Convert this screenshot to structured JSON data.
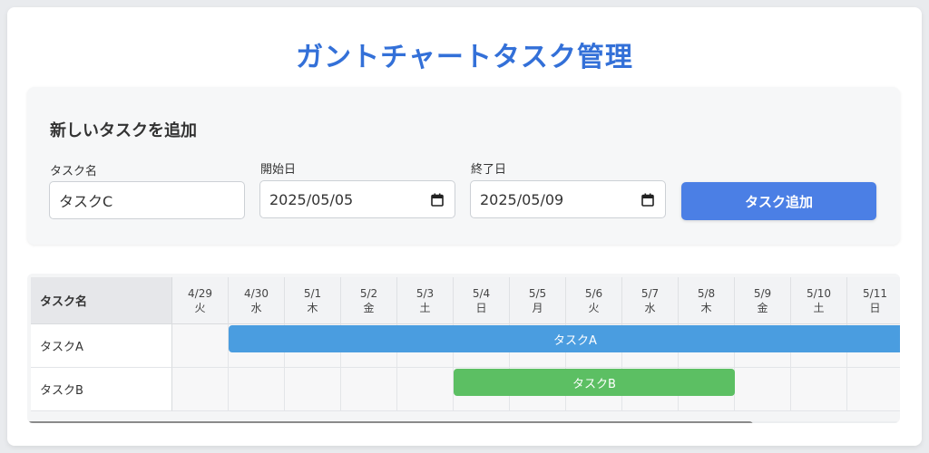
{
  "title": "ガントチャートタスク管理",
  "form": {
    "heading": "新しいタスクを追加",
    "task_name_label": "タスク名",
    "task_name_value": "タスクC",
    "start_label": "開始日",
    "start_value": "2025/05/05",
    "end_label": "終了日",
    "end_value": "2025/05/09",
    "add_button": "タスク追加",
    "calendar_icon": "calendar-icon"
  },
  "gantt": {
    "name_header": "タスク名",
    "days": [
      {
        "date": "4/29",
        "weekday": "火"
      },
      {
        "date": "4/30",
        "weekday": "水"
      },
      {
        "date": "5/1",
        "weekday": "木"
      },
      {
        "date": "5/2",
        "weekday": "金"
      },
      {
        "date": "5/3",
        "weekday": "土"
      },
      {
        "date": "5/4",
        "weekday": "日"
      },
      {
        "date": "5/5",
        "weekday": "月"
      },
      {
        "date": "5/6",
        "weekday": "火"
      },
      {
        "date": "5/7",
        "weekday": "水"
      },
      {
        "date": "5/8",
        "weekday": "木"
      },
      {
        "date": "5/9",
        "weekday": "金"
      },
      {
        "date": "5/10",
        "weekday": "土"
      },
      {
        "date": "5/11",
        "weekday": "日"
      }
    ],
    "tasks": [
      {
        "name": "タスクA",
        "bar_label": "タスクA",
        "start": "4/30",
        "end": "5/11",
        "color": "#4a9de0"
      },
      {
        "name": "タスクB",
        "bar_label": "タスクB",
        "start": "5/4",
        "end": "5/8",
        "color": "#5cbf63"
      }
    ]
  },
  "colors": {
    "title": "#3370d8",
    "button": "#4b7fe5"
  }
}
